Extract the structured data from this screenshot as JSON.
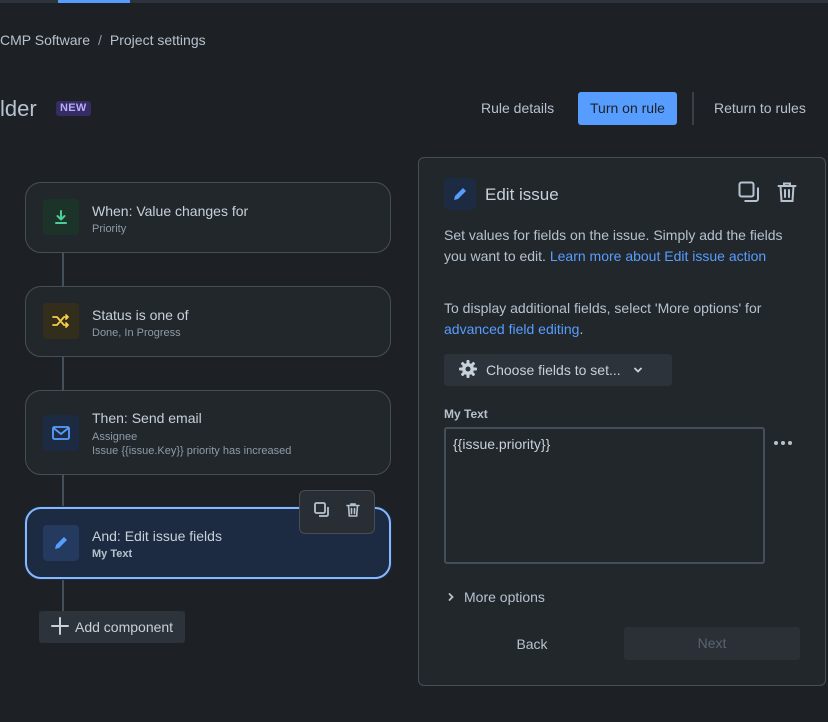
{
  "breadcrumb": {
    "project": "CMP Software",
    "separator": "/",
    "current": "Project settings"
  },
  "header": {
    "title": "lder",
    "badge": "NEW",
    "rule_details": "Rule details",
    "turn_on_rule": "Turn on rule",
    "return_to_rules": "Return to rules"
  },
  "components": [
    {
      "title": "When: Value changes for",
      "sub1": "Priority",
      "icon": "download-icon",
      "color": "#4bce97"
    },
    {
      "title": "Status is one of",
      "sub1": "Done, In Progress",
      "icon": "shuffle-icon",
      "color": "#f5cd47"
    },
    {
      "title": "Then: Send email",
      "sub1": "Assignee",
      "sub2": "Issue {{issue.Key}} priority has increased",
      "icon": "mail-icon",
      "color": "#579dff"
    },
    {
      "title": "And: Edit issue fields",
      "sub1": "My Text",
      "icon": "pencil-icon",
      "color": "#579dff"
    }
  ],
  "add_component": "Add component",
  "panel": {
    "title": "Edit issue",
    "desc1_text": "Set values for fields on the issue. Simply add the fields you want to edit. ",
    "desc1_link": "Learn more about Edit issue action",
    "desc2_text": "To display additional fields, select 'More options' for ",
    "desc2_link": "advanced field editing",
    "desc2_end": ".",
    "choose_fields": "Choose fields to set...",
    "field_label": "My Text",
    "field_value": "{{issue.priority}}",
    "more_options": "More options",
    "back": "Back",
    "next": "Next"
  },
  "colors": {
    "accent": "#579dff",
    "background": "#1d2125",
    "surface": "#22272b"
  }
}
